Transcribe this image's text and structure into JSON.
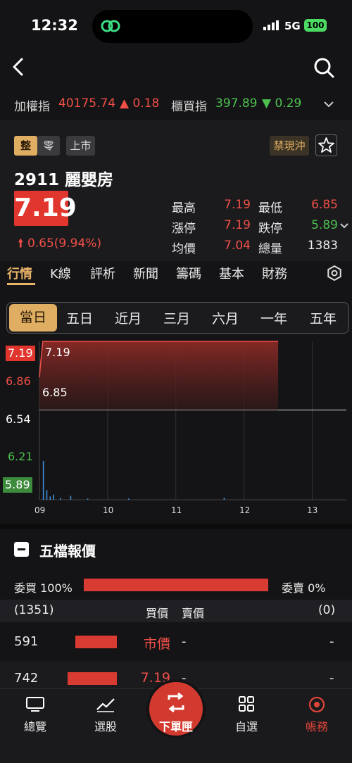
{
  "status": {
    "time": "12:32",
    "network": "5G",
    "battery": "100"
  },
  "indices": [
    {
      "name": "加權指",
      "value": "40175.74",
      "change": "▲ 0.18"
    },
    {
      "name": "櫃買指",
      "value": "397.89",
      "change": "▼ 0.29"
    }
  ],
  "stock": {
    "tags": [
      "整",
      "零",
      "上市"
    ],
    "restriction": "禁現沖",
    "code": "2911",
    "name": "麗嬰房",
    "price": "7.19",
    "change": "0.65",
    "change_pct": "(9.94%)",
    "stats": {
      "high_label": "最高",
      "high": "7.19",
      "low_label": "最低",
      "low": "6.85",
      "limit_up_label": "漲停",
      "limit_up": "7.19",
      "limit_down_label": "跌停",
      "limit_down": "5.89",
      "avg_label": "均價",
      "avg": "7.04",
      "volume_label": "總量",
      "volume": "1383"
    }
  },
  "tabs": [
    "行情",
    "K線",
    "評析",
    "新聞",
    "籌碼",
    "基本",
    "財務"
  ],
  "periods": [
    "當日",
    "五日",
    "近月",
    "三月",
    "六月",
    "一年",
    "五年"
  ],
  "chart_data": {
    "type": "area",
    "y_ticks": [
      "7.19",
      "6.86",
      "6.54",
      "6.21",
      "5.89"
    ],
    "x_ticks": [
      "09",
      "10",
      "11",
      "12",
      "13"
    ],
    "reference": 6.54,
    "ylim": [
      5.89,
      7.19
    ],
    "annotations": [
      "7.19",
      "6.85"
    ],
    "price": {
      "x": [
        9.0,
        9.02,
        9.05,
        9.1,
        12.5
      ],
      "y": [
        6.85,
        7.0,
        7.19,
        7.19,
        7.19
      ]
    },
    "volume": {
      "x": [
        9.05,
        9.1,
        9.15,
        9.2,
        9.3,
        9.45,
        9.7,
        10.3,
        11.7
      ],
      "y": [
        60,
        15,
        5,
        8,
        3,
        6,
        2,
        2,
        3
      ]
    }
  },
  "order_book": {
    "title": "五檔報價",
    "buy_label": "委買",
    "buy_pct": "100%",
    "sell_label": "委賣",
    "sell_pct": "0%",
    "buy_ratio": 1.0,
    "bid_count": "(1351)",
    "ask_count": "(0)",
    "bid_header": "買價",
    "ask_header": "賣價",
    "rows": [
      {
        "bid_vol": "591",
        "bid": "市價",
        "ask": "-",
        "ask_vol": "-",
        "fill": 0.85
      },
      {
        "bid_vol": "742",
        "bid": "7.19",
        "ask": "-",
        "ask_vol": "-",
        "fill": 1.0
      }
    ]
  },
  "bottom_nav": [
    "總覽",
    "選股",
    "下單匣",
    "自選",
    "帳務"
  ],
  "colors": {
    "up": "#f04f47",
    "down": "#4cc14e",
    "accent": "#e0ae62",
    "primary": "#d23a2f"
  }
}
